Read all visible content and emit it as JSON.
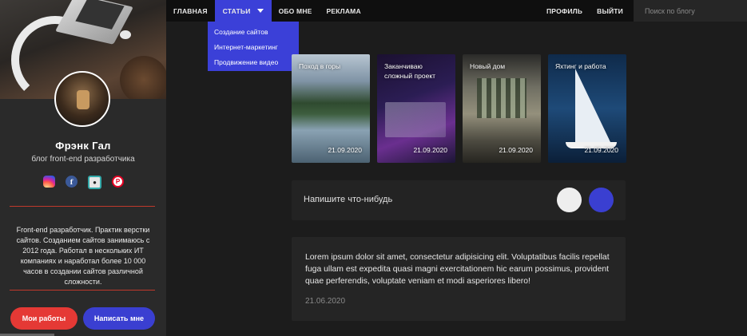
{
  "nav": {
    "items": [
      {
        "label": "ГЛАВНАЯ"
      },
      {
        "label": "СТАТЬИ"
      },
      {
        "label": "ОБО МНЕ"
      },
      {
        "label": "РЕКЛАМА"
      }
    ],
    "profile": "ПРОФИЛЬ",
    "logout": "ВЫЙТИ",
    "search_placeholder": "Поиск по блогу"
  },
  "dropdown": {
    "items": [
      "Создание сайтов",
      "Интернет-маркетинг",
      "Продвижение видео"
    ]
  },
  "profile": {
    "name": "Фрэнк Гал",
    "subtitle": "блог front-end разработчика",
    "socials": [
      "instagram-icon",
      "facebook-icon",
      "github-icon",
      "pinterest-icon"
    ],
    "bio": "Front-end разработчик. Практик верстки сайтов. Созданием сайтов занимаюсь с 2012 года. Работал в нескольких ИТ компаниях и наработал более 10 000 часов в создании сайтов различной сложности.",
    "btn_works": "Мои работы",
    "btn_write": "Написать мне"
  },
  "cards": [
    {
      "title": "Поход в горы",
      "date": "21.09.2020"
    },
    {
      "title": "Заканчиваю сложный проект",
      "date": "21.09.2020"
    },
    {
      "title": "Новый дом",
      "date": "21.09.2020"
    },
    {
      "title": "Яхтинг и работа",
      "date": "21.09.2020"
    }
  ],
  "composer": {
    "placeholder": "Напишите что-нибудь"
  },
  "post": {
    "text": "Lorem ipsum dolor sit amet, consectetur adipisicing elit. Voluptatibus facilis repellat fuga ullam est expedita quasi magni exercitationem hic earum possimus, provident quae perferendis, voluptate veniam et modi asperiores libero!",
    "date": "21.06.2020"
  },
  "colors": {
    "accent_blue": "#3b40d8",
    "accent_red": "#e53935",
    "background": "#1c1c1c",
    "sidebar": "#2a2a2a"
  }
}
